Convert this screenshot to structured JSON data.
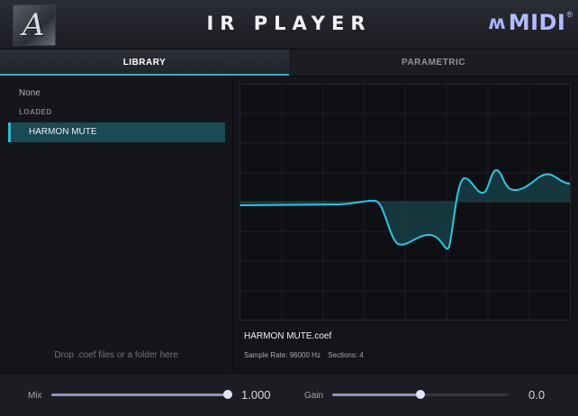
{
  "header": {
    "title": "IR PLAYER",
    "logo_letter": "A",
    "brand_text": "MIDI",
    "brand_reg": "®"
  },
  "tabs": [
    {
      "label": "LIBRARY",
      "active": true
    },
    {
      "label": "PARAMETRIC",
      "active": false
    }
  ],
  "library": {
    "none_label": "None",
    "loaded_header": "LOADED",
    "selected_item": "HARMON MUTE",
    "drop_hint": "Drop .coef files or a folder here"
  },
  "ir": {
    "file_name": "HARMON MUTE.coef",
    "sample_rate_text": "Sample Rate: 96000 Hz",
    "sections_text": "Sections: 4"
  },
  "controls": {
    "mix": {
      "label": "Mix",
      "value_text": "1.000",
      "fraction": 1.0
    },
    "gain": {
      "label": "Gain",
      "value_text": "0.0",
      "fraction": 0.5
    }
  },
  "colors": {
    "accent": "#2fb1cf",
    "curve": "#2fc6e6",
    "brand": "#b3baff"
  }
}
